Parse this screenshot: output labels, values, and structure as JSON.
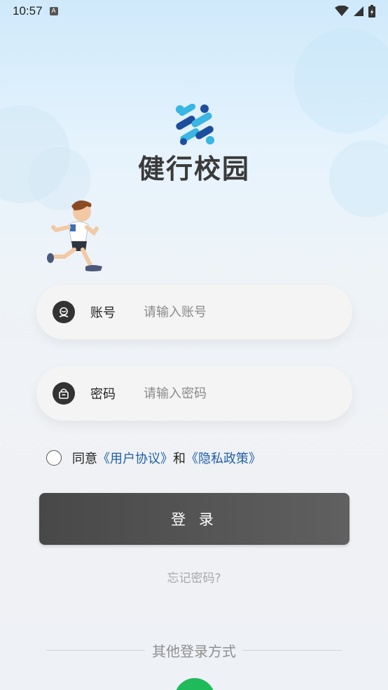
{
  "status_bar": {
    "time": "10:57",
    "badge": "A",
    "icons": [
      "wifi-icon",
      "signal-icon",
      "battery-charging-icon"
    ]
  },
  "app": {
    "title": "健行校园",
    "logo": "app-logo-icon",
    "mascot": "running-student-illustration"
  },
  "account_field": {
    "icon": "user-icon",
    "label": "账号",
    "placeholder": "请输入账号",
    "value": ""
  },
  "password_field": {
    "icon": "lock-icon",
    "label": "密码",
    "placeholder": "请输入密码",
    "value": ""
  },
  "agreement": {
    "checked": false,
    "prefix": "同意",
    "user_agreement": "《用户协议》",
    "conjunction": "和",
    "privacy_policy": "《隐私政策》"
  },
  "login_button": {
    "label": "登 录"
  },
  "forgot_password": "忘记密码?",
  "other_login": {
    "label": "其他登录方式",
    "methods": [
      "wechat-icon"
    ]
  },
  "colors": {
    "link": "#1f5fa8",
    "button": "#505050",
    "wechat": "#1fba5a",
    "logo_light": "#39b6e3",
    "logo_dark": "#1d4e9e"
  }
}
